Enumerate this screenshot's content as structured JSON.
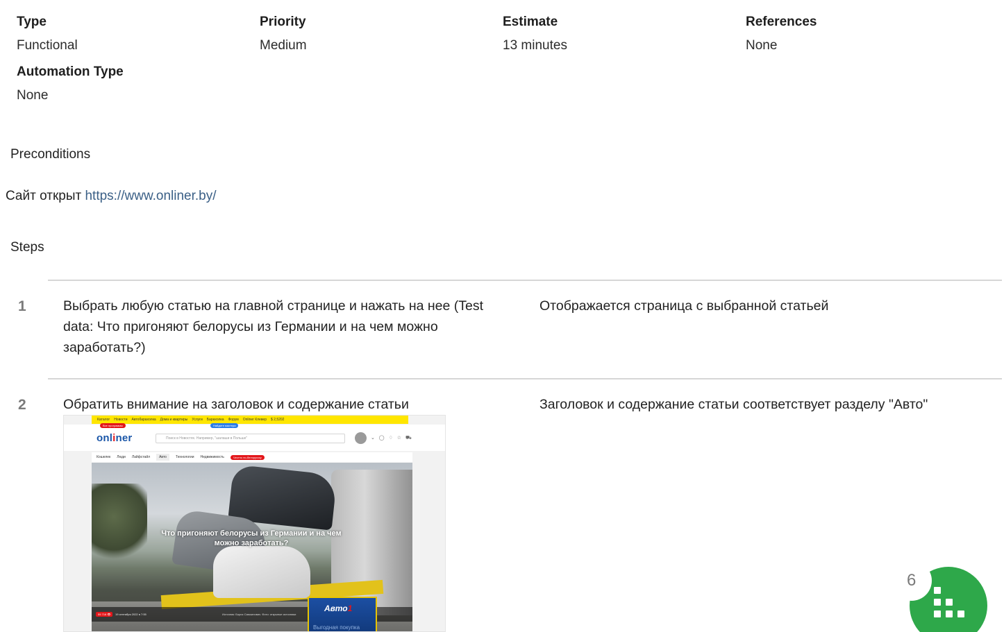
{
  "meta": {
    "type": {
      "label": "Type",
      "value": "Functional"
    },
    "priority": {
      "label": "Priority",
      "value": "Medium"
    },
    "estimate": {
      "label": "Estimate",
      "value": "13 minutes"
    },
    "references": {
      "label": "References",
      "value": "None"
    },
    "automation": {
      "label": "Automation Type",
      "value": "None"
    }
  },
  "preconditions": {
    "title": "Preconditions",
    "text": "Сайт открыт",
    "link": "https://www.onliner.by/"
  },
  "steps": {
    "title": "Steps",
    "items": [
      {
        "number": "1",
        "action": "Выбрать любую статью на главной странице и нажать на нее (Test data: Что пригоняют белорусы из Германии и на чем можно заработать?)",
        "expected": "Отображается страница с выбранной статьей"
      },
      {
        "number": "2",
        "action": "Обратить внимание на заголовок и содержание статьи",
        "expected": "Заголовок и содержание статьи соответствует разделу \"Авто\""
      }
    ]
  },
  "screenshot": {
    "topbar": [
      "Каталог",
      "Новости",
      "Автобарахолка",
      "Дома и квартиры",
      "Услуги",
      "Барахолка",
      "Форум",
      "Onliner Клевер",
      "$ 2,5202"
    ],
    "red_pill": "Все программы",
    "blue_pill": "Найдите мастера",
    "logo_main": "onl",
    "logo_accent": "i",
    "logo_tail": "ner",
    "search_placeholder": "Поиск в Новостях. Например, \"шалаши в Польше\"",
    "nav": [
      "Кошелек",
      "Люди",
      "Лайфстайл",
      "Авто",
      "Технологии",
      "Недвижимость"
    ],
    "nav_pill": "Честно по-белорусску",
    "headline": "Что пригоняют белорусы из Германии и на чем можно заработать?",
    "views": "55 716 👁",
    "date": "19 сентября 2022 в 7:55",
    "source": "Источник: Борис Самоилович. Фото: открытые источники",
    "ad_logo_main": "Авто",
    "ad_logo_accent": "1",
    "ad_text": "Выгодная покупка"
  },
  "widget": {
    "count": "6",
    "icon": "grid-icon",
    "color": "#2ea84a"
  }
}
